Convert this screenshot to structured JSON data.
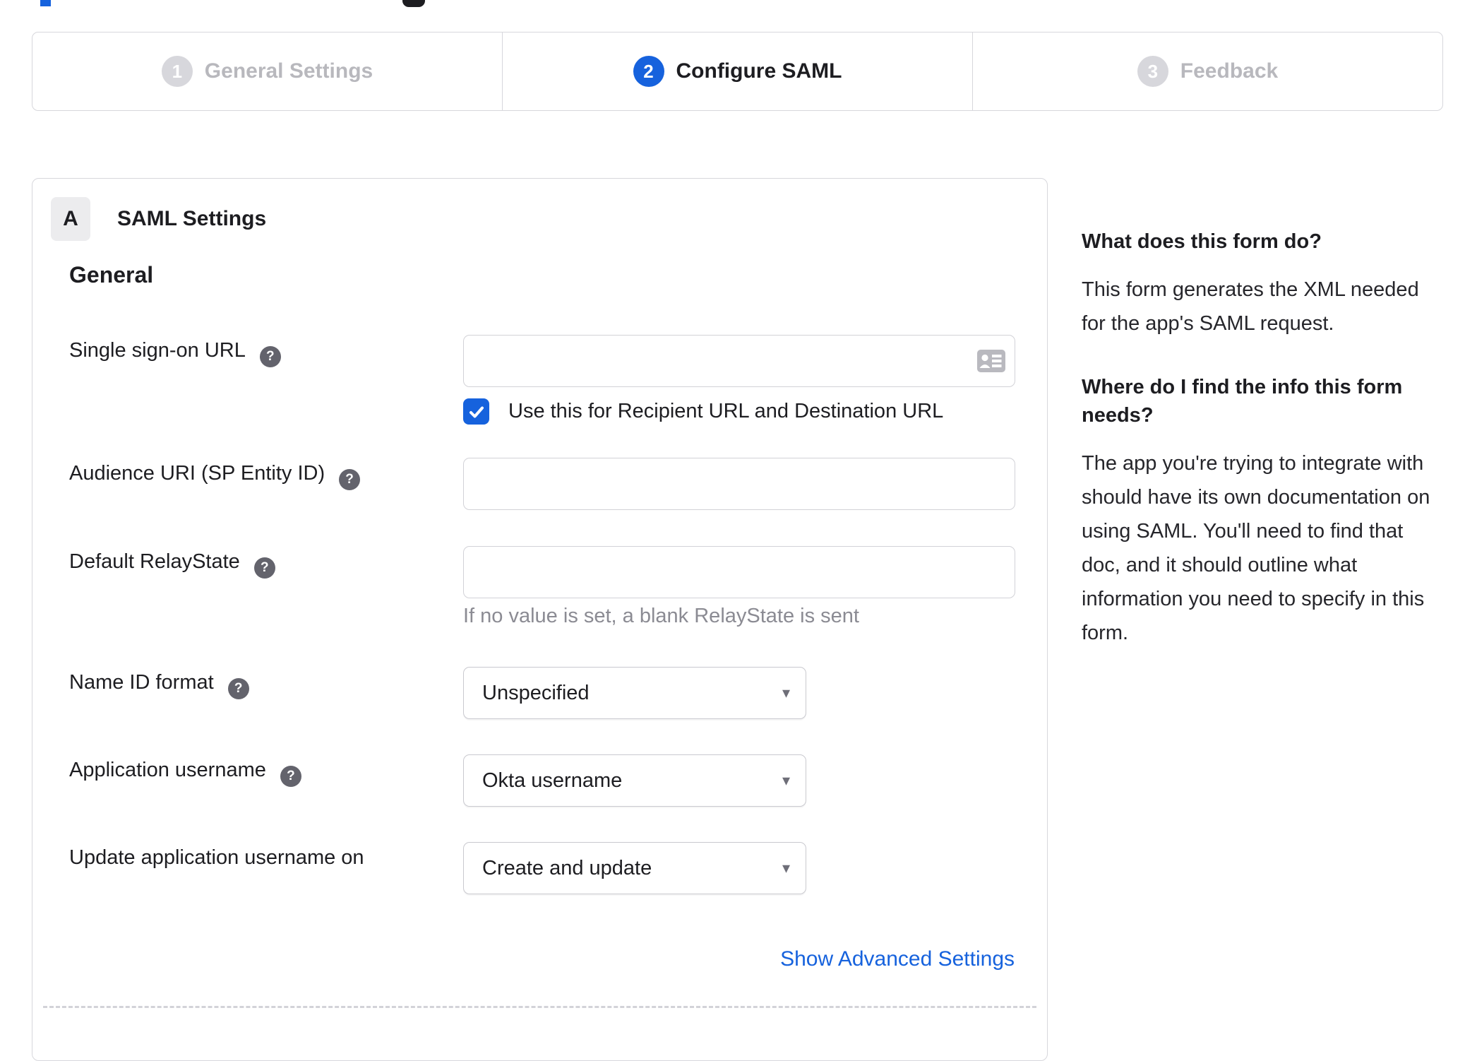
{
  "colors": {
    "accent_blue": "#1662dd",
    "border_gray": "#d7d7dc",
    "text_dark": "#1d1d21",
    "inactive_gray": "#b8b8bd",
    "hint_gray": "#8b8b93",
    "help_icon_bg": "#63636c"
  },
  "icons": {
    "help_glyph": "?",
    "caret_glyph": "▾"
  },
  "stepper": {
    "steps": [
      {
        "number": "1",
        "label": "General Settings",
        "state": "inactive"
      },
      {
        "number": "2",
        "label": "Configure SAML",
        "state": "active"
      },
      {
        "number": "3",
        "label": "Feedback",
        "state": "inactive"
      }
    ]
  },
  "panel": {
    "section_badge": "A",
    "section_title": "SAML Settings",
    "group_title": "General",
    "fields": [
      {
        "label": "Single sign-on URL",
        "type": "text",
        "value": "",
        "checkbox_label": "Use this for Recipient URL and Destination URL",
        "checkbox_checked": true
      },
      {
        "label": "Audience URI (SP Entity ID)",
        "type": "text",
        "value": ""
      },
      {
        "label": "Default RelayState",
        "type": "text",
        "value": "",
        "hint": "If no value is set, a blank RelayState is sent"
      },
      {
        "label": "Name ID format",
        "type": "select",
        "value": "Unspecified"
      },
      {
        "label": "Application username",
        "type": "select",
        "value": "Okta username"
      },
      {
        "label": "Update application username on",
        "type": "select",
        "value": "Create and update"
      }
    ],
    "advanced_link": "Show Advanced Settings"
  },
  "sidebar": {
    "sections": [
      {
        "heading": "What does this form do?",
        "body": "This form generates the XML needed for the app's SAML request."
      },
      {
        "heading": "Where do I find the info this form needs?",
        "body": "The app you're trying to integrate with should have its own documentation on using SAML. You'll need to find that doc, and it should outline what information you need to specify in this form."
      }
    ]
  }
}
